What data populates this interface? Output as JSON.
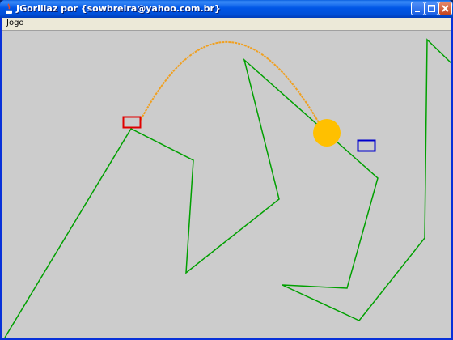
{
  "window": {
    "title": "JGorillaz por {sowbreira@yahoo.com.br}",
    "controls": [
      "minimize",
      "maximize",
      "close"
    ]
  },
  "menubar": {
    "items": [
      {
        "label": "Jogo"
      }
    ]
  },
  "game": {
    "background_color": "#cccccc",
    "terrain_color": "#00a000",
    "trajectory_color": "#f0a020",
    "player1_color": "#e00000",
    "player2_color": "#0000cc",
    "sun_color": "#ffc000"
  }
}
